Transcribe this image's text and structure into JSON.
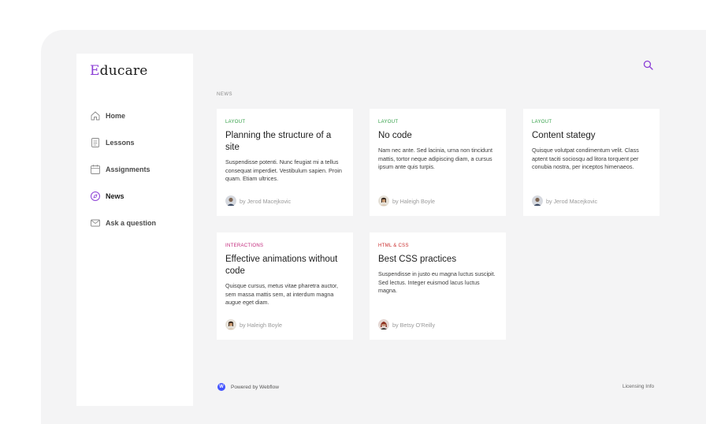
{
  "brand": {
    "logo_first": "E",
    "logo_rest": "ducare"
  },
  "sidebar": {
    "items": [
      {
        "label": "Home",
        "icon": "home-icon"
      },
      {
        "label": "Lessons",
        "icon": "lessons-icon"
      },
      {
        "label": "Assignments",
        "icon": "calendar-icon"
      },
      {
        "label": "News",
        "icon": "compass-icon",
        "active": true
      },
      {
        "label": "Ask a question",
        "icon": "mail-icon"
      }
    ]
  },
  "header": {
    "search_icon": "search-icon"
  },
  "main": {
    "section_label": "NEWS",
    "cards": [
      {
        "category": "Layout",
        "category_color": "#2f9e44",
        "title": "Planning the structure of a site",
        "excerpt": "Suspendisse potenti. Nunc feugiat mi a tellus consequat imperdiet. Vestibulum sapien. Proin quam. Etiam ultrices.",
        "author": "by Jerod Macejkovic"
      },
      {
        "category": "Layout",
        "category_color": "#2f9e44",
        "title": "No code",
        "excerpt": "Nam nec ante. Sed lacinia, urna non tincidunt mattis, tortor neque adipiscing diam, a cursus ipsum ante quis turpis.",
        "author": "by Haleigh Boyle"
      },
      {
        "category": "Layout",
        "category_color": "#2f9e44",
        "title": "Content stategy",
        "excerpt": "Quisque volutpat condimentum velit. Class aptent taciti sociosqu ad litora torquent per conubia nostra, per inceptos himenaeos.",
        "author": "by Jerod Macejkovic"
      },
      {
        "category": "Interactions",
        "category_color": "#c2257a",
        "title": "Effective animations without code",
        "excerpt": "Quisque cursus, metus vitae pharetra auctor, sem massa mattis sem, at interdum magna augue eget diam.",
        "author": "by Haleigh Boyle"
      },
      {
        "category": "HTML & CSS",
        "category_color": "#c92a2a",
        "title": "Best CSS practices",
        "excerpt": "Suspendisse in justo eu magna luctus suscipit. Sed lectus. Integer euismod lacus luctus magna.",
        "author": "by Betsy O'Reilly"
      }
    ]
  },
  "footer": {
    "powered": "Powered by Webflow",
    "licensing": "Licensing Info"
  },
  "colors": {
    "accent": "#8c3fd6",
    "background": "#f4f4f5"
  }
}
